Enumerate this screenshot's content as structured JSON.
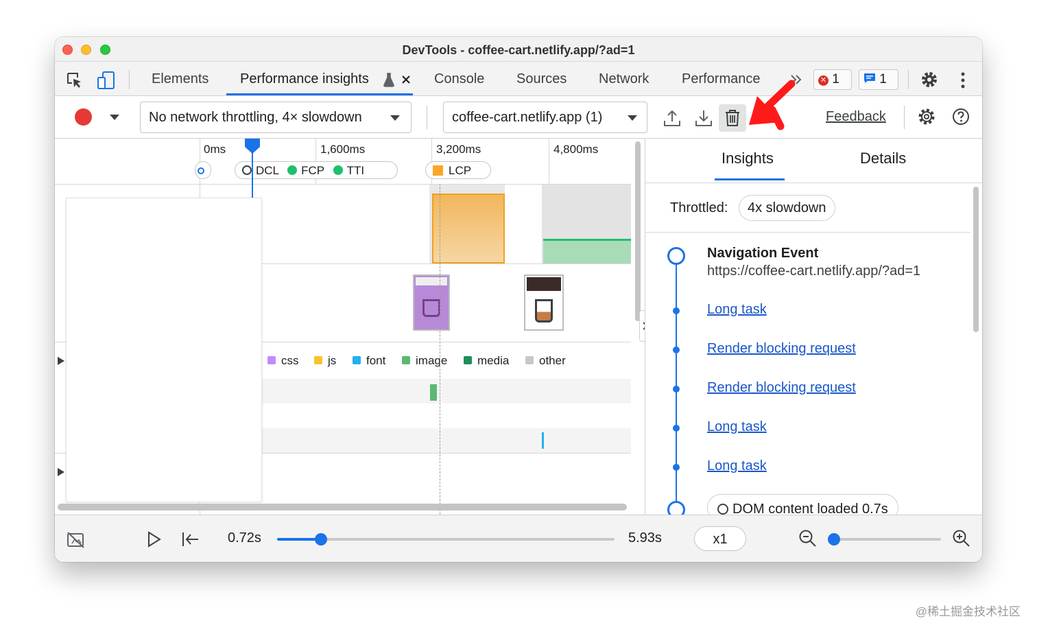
{
  "window": {
    "title": "DevTools - coffee-cart.netlify.app/?ad=1"
  },
  "tabs": [
    {
      "label": "Elements"
    },
    {
      "label": "Performance insights"
    },
    {
      "label": "Console"
    },
    {
      "label": "Sources"
    },
    {
      "label": "Network"
    },
    {
      "label": "Performance"
    }
  ],
  "badges": {
    "errors": "1",
    "messages": "1"
  },
  "toolbar": {
    "throttling": "No network throttling, 4× slowdown",
    "recording": "coffee-cart.netlify.app (1)",
    "feedback": "Feedback"
  },
  "ruler": {
    "t0": "0ms",
    "t1": "1,600ms",
    "t2": "3,200ms",
    "t3": "4,800ms"
  },
  "markers": {
    "dcl": "DCL",
    "fcp": "FCP",
    "tti": "TTI",
    "lcp": "LCP"
  },
  "legend": [
    {
      "label": "css",
      "color": "#c58af9"
    },
    {
      "label": "js",
      "color": "#f9c22e"
    },
    {
      "label": "font",
      "color": "#24b0ee"
    },
    {
      "label": "image",
      "color": "#5bb974"
    },
    {
      "label": "media",
      "color": "#1e8e5e"
    },
    {
      "label": "other",
      "color": "#c8c8c8"
    }
  ],
  "insights": {
    "tab_insights": "Insights",
    "tab_details": "Details",
    "throttled_label": "Throttled:",
    "throttled_value": "4x slowdown",
    "nav_title": "Navigation Event",
    "nav_url": "https://coffee-cart.netlify.app/?ad=1",
    "items": [
      "Long task",
      "Render blocking request",
      "Render blocking request",
      "Long task",
      "Long task"
    ],
    "dom_loaded": "DOM content loaded 0.7s"
  },
  "playback": {
    "current": "0.72s",
    "total": "5.93s",
    "speed": "x1",
    "progress": 0.13,
    "zoom": 0.05
  },
  "colors": {
    "accent": "#1a73e8",
    "record": "#e53935",
    "annotation_arrow": "#ff1a1a"
  },
  "watermark": "@稀土掘金技术社区"
}
